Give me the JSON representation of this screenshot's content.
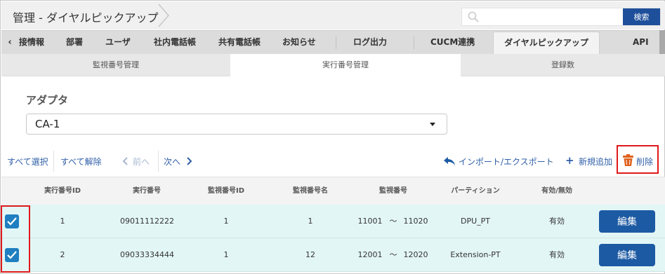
{
  "header": {
    "title": "管理 - ダイヤルピックアップ",
    "search_placeholder": "",
    "search_button": "検索"
  },
  "tabs": {
    "scroll_left": "‹",
    "items": [
      {
        "label": "接情報"
      },
      {
        "label": "部署"
      },
      {
        "label": "ユーザ"
      },
      {
        "label": "社内電話帳"
      },
      {
        "label": "共有電話帳"
      },
      {
        "label": "お知らせ"
      },
      {
        "label": "ログ出力"
      },
      {
        "label": "CUCM連携"
      },
      {
        "label": "ダイヤルピックアップ"
      },
      {
        "label": "API"
      }
    ],
    "active_index": 8
  },
  "subtabs": {
    "items": [
      {
        "label": "監視番号管理"
      },
      {
        "label": "実行番号管理"
      },
      {
        "label": "登録数"
      }
    ],
    "active_index": 1
  },
  "adapter": {
    "label": "アダプタ",
    "value": "CA-1"
  },
  "toolbar": {
    "select_all": "すべて選択",
    "deselect_all": "すべて解除",
    "prev": "前へ",
    "next": "次へ",
    "import_export": "インポート/エクスポート",
    "add_new": "新規追加",
    "delete": "削除"
  },
  "table": {
    "columns": [
      "実行番号ID",
      "実行番号",
      "監視番号ID",
      "監視番号名",
      "監視番号",
      "パーティション",
      "有効/無効"
    ],
    "rows": [
      {
        "checked": true,
        "exec_id": "1",
        "exec_number": "09011112222",
        "monitor_id": "1",
        "monitor_name": "1",
        "monitor_number_from": "11001",
        "tilde": "～",
        "monitor_number_to": "11020",
        "partition": "DPU_PT",
        "enabled": "有効",
        "edit": "編集"
      },
      {
        "checked": true,
        "exec_id": "2",
        "exec_number": "09033334444",
        "monitor_id": "1",
        "monitor_name": "12",
        "monitor_number_from": "12001",
        "tilde": "～",
        "monitor_number_to": "12020",
        "partition": "Extension-PT",
        "enabled": "有効",
        "edit": "編集"
      }
    ]
  },
  "colors": {
    "primary": "#1c5aa3",
    "link": "#2f5fa8",
    "row_selected": "#e3f6f6",
    "highlight": "#e0191b",
    "trash": "#e0601b"
  }
}
